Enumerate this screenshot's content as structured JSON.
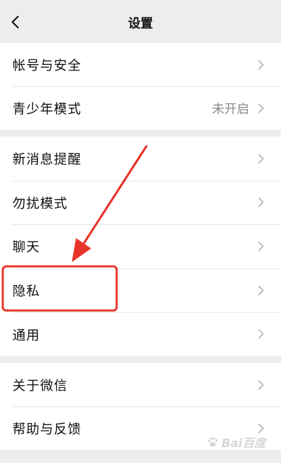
{
  "header": {
    "title": "设置"
  },
  "groups": [
    {
      "items": [
        {
          "label": "帐号与安全"
        },
        {
          "label": "青少年模式",
          "value": "未开启"
        }
      ]
    },
    {
      "items": [
        {
          "label": "新消息提醒"
        },
        {
          "label": "勿扰模式"
        },
        {
          "label": "聊天"
        },
        {
          "label": "隐私"
        },
        {
          "label": "通用"
        }
      ]
    },
    {
      "items": [
        {
          "label": "关于微信"
        },
        {
          "label": "帮助与反馈"
        }
      ]
    }
  ],
  "annotation": {
    "arrow_color": "#e8342a",
    "highlight_color": "#e8342a",
    "highlighted_item": "隐私"
  },
  "watermark": {
    "text": "Bai百度"
  },
  "icons": {
    "back": "chevron-left-icon",
    "row_arrow": "chevron-right-icon"
  }
}
